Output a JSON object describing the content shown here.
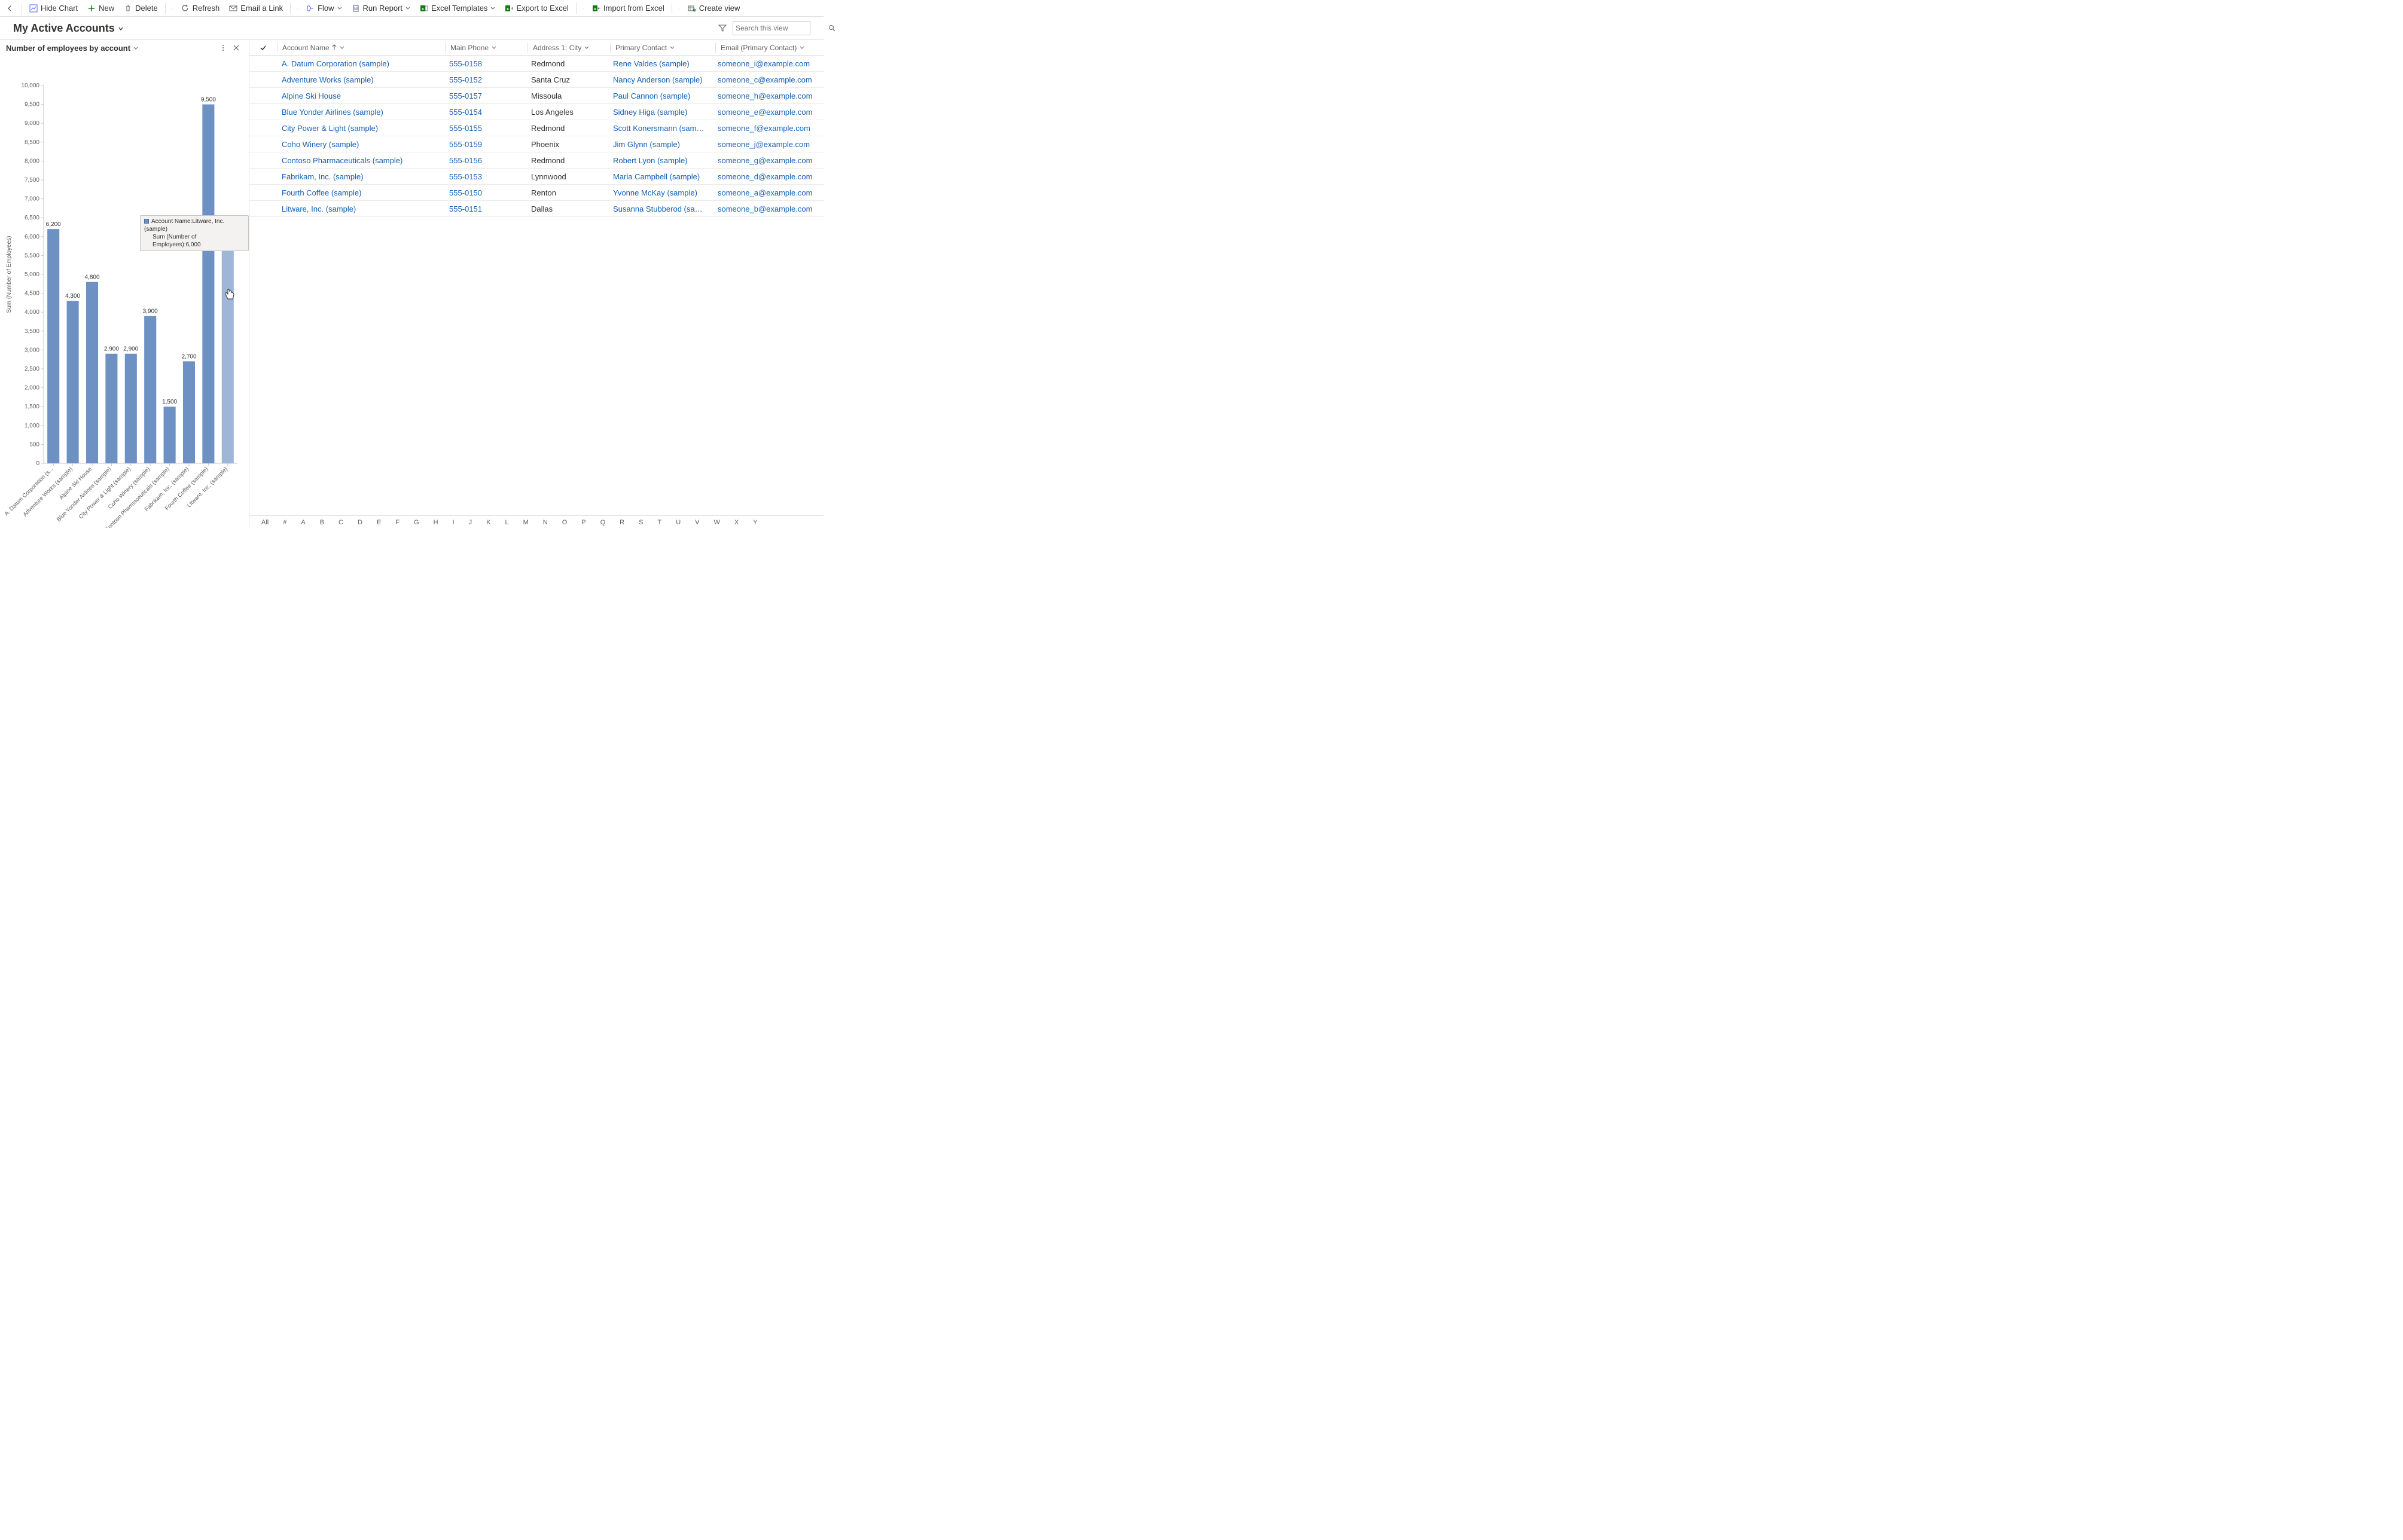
{
  "cmdbar": {
    "hide_chart": "Hide Chart",
    "new": "New",
    "delete": "Delete",
    "refresh": "Refresh",
    "email_link": "Email a Link",
    "flow": "Flow",
    "run_report": "Run Report",
    "excel_templates": "Excel Templates",
    "export_excel": "Export to Excel",
    "import_excel": "Import from Excel",
    "create_view": "Create view"
  },
  "view": {
    "title": "My Active Accounts",
    "search_placeholder": "Search this view"
  },
  "chart": {
    "title": "Number of employees by account",
    "yaxis_label": "Sum (Number of Employees)",
    "tooltip_line1": "Account Name:Litware, Inc. (sample)",
    "tooltip_line2": "Sum (Number of Employees):6,000"
  },
  "chart_data": {
    "type": "bar",
    "title": "Number of employees by account",
    "ylabel": "Sum (Number of Employees)",
    "xlabel": "",
    "ylim": [
      0,
      10000
    ],
    "categories": [
      "A. Datum Corporation (s...",
      "Adventure Works (sample)",
      "Alpine Ski House",
      "Blue Yonder Airlines (sample)",
      "City Power & Light (sample)",
      "Coho Winery (sample)",
      "Contoso Pharmaceuticals (sample)",
      "Fabrikam, Inc. (sample)",
      "Fourth Coffee (sample)",
      "Litware, Inc. (sample)"
    ],
    "values": [
      6200,
      4300,
      4800,
      2900,
      2900,
      3900,
      1500,
      2700,
      9500,
      6000
    ],
    "value_labels": [
      "6,200",
      "4,300",
      "4,800",
      "2,900",
      "2,900",
      "3,900",
      "1,500",
      "2,700",
      "9,500",
      "6,000"
    ],
    "yticks": [
      0,
      500,
      1000,
      1500,
      2000,
      2500,
      3000,
      3500,
      4000,
      4500,
      5000,
      5500,
      6000,
      6500,
      7000,
      7500,
      8000,
      8500,
      9000,
      9500,
      10000
    ],
    "ytick_labels": [
      "0",
      "500",
      "1,000",
      "1,500",
      "2,000",
      "2,500",
      "3,000",
      "3,500",
      "4,000",
      "4,500",
      "5,000",
      "5,500",
      "6,000",
      "6,500",
      "7,000",
      "7,500",
      "8,000",
      "8,500",
      "9,000",
      "9,500",
      "10,000"
    ]
  },
  "grid": {
    "columns": {
      "name": "Account Name",
      "phone": "Main Phone",
      "city": "Address 1: City",
      "contact": "Primary Contact",
      "email": "Email (Primary Contact)"
    },
    "rows": [
      {
        "name": "A. Datum Corporation (sample)",
        "phone": "555-0158",
        "city": "Redmond",
        "contact": "Rene Valdes (sample)",
        "email": "someone_i@example.com"
      },
      {
        "name": "Adventure Works (sample)",
        "phone": "555-0152",
        "city": "Santa Cruz",
        "contact": "Nancy Anderson (sample)",
        "email": "someone_c@example.com"
      },
      {
        "name": "Alpine Ski House",
        "phone": "555-0157",
        "city": "Missoula",
        "contact": "Paul Cannon (sample)",
        "email": "someone_h@example.com"
      },
      {
        "name": "Blue Yonder Airlines (sample)",
        "phone": "555-0154",
        "city": "Los Angeles",
        "contact": "Sidney Higa (sample)",
        "email": "someone_e@example.com"
      },
      {
        "name": "City Power & Light (sample)",
        "phone": "555-0155",
        "city": "Redmond",
        "contact": "Scott Konersmann (sample)",
        "email": "someone_f@example.com"
      },
      {
        "name": "Coho Winery (sample)",
        "phone": "555-0159",
        "city": "Phoenix",
        "contact": "Jim Glynn (sample)",
        "email": "someone_j@example.com"
      },
      {
        "name": "Contoso Pharmaceuticals (sample)",
        "phone": "555-0156",
        "city": "Redmond",
        "contact": "Robert Lyon (sample)",
        "email": "someone_g@example.com"
      },
      {
        "name": "Fabrikam, Inc. (sample)",
        "phone": "555-0153",
        "city": "Lynnwood",
        "contact": "Maria Campbell (sample)",
        "email": "someone_d@example.com"
      },
      {
        "name": "Fourth Coffee (sample)",
        "phone": "555-0150",
        "city": "Renton",
        "contact": "Yvonne McKay (sample)",
        "email": "someone_a@example.com"
      },
      {
        "name": "Litware, Inc. (sample)",
        "phone": "555-0151",
        "city": "Dallas",
        "contact": "Susanna Stubberod (sample)",
        "email": "someone_b@example.com"
      }
    ]
  },
  "alphabar": [
    "All",
    "#",
    "A",
    "B",
    "C",
    "D",
    "E",
    "F",
    "G",
    "H",
    "I",
    "J",
    "K",
    "L",
    "M",
    "N",
    "O",
    "P",
    "Q",
    "R",
    "S",
    "T",
    "U",
    "V",
    "W",
    "X",
    "Y"
  ]
}
